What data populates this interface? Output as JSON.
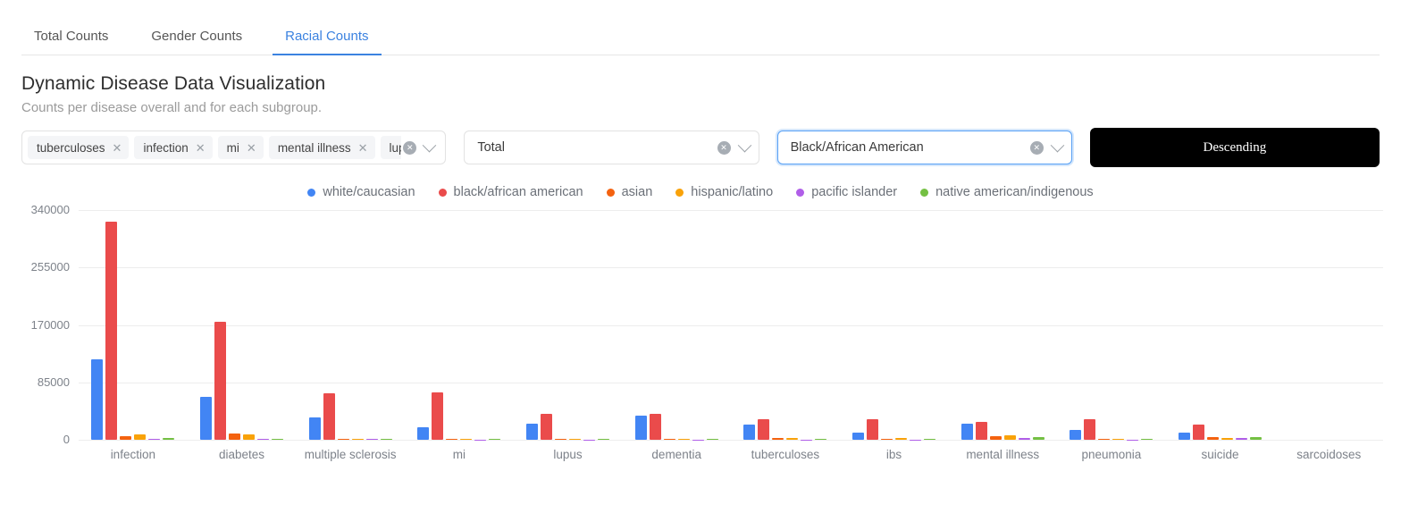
{
  "tabs": [
    {
      "label": "Total Counts",
      "active": false
    },
    {
      "label": "Gender Counts",
      "active": false
    },
    {
      "label": "Racial Counts",
      "active": true
    }
  ],
  "header": {
    "title": "Dynamic Disease Data Visualization",
    "subtitle": "Counts per disease overall and for each subgroup."
  },
  "controls": {
    "disease_multiselect": {
      "chips": [
        "tuberculoses",
        "infection",
        "mi",
        "mental illness",
        "lup"
      ],
      "clear_icon": "clear-circle-icon",
      "chevron_icon": "chevron-down-icon"
    },
    "metric_select": {
      "value": "Total",
      "clear_icon": "clear-circle-icon",
      "chevron_icon": "chevron-down-icon"
    },
    "subgroup_select": {
      "value": "Black/African American",
      "focused": true,
      "clear_icon": "clear-circle-icon",
      "chevron_icon": "chevron-down-icon"
    },
    "sort_button": {
      "label": "Descending"
    }
  },
  "colors": {
    "accent": "#3b82e0",
    "white_caucasian": "#4285f4",
    "black_african_american": "#ea4b4b",
    "asian": "#f4620f",
    "hispanic_latino": "#f9a209",
    "pacific_islander": "#b05ee8",
    "native_american_indigenous": "#74c043",
    "button_bg": "#000000",
    "grid": "#ededed"
  },
  "chart_data": {
    "type": "bar",
    "title": "",
    "xlabel": "",
    "ylabel": "",
    "ylim": [
      0,
      340000
    ],
    "yticks": [
      0,
      85000,
      170000,
      255000,
      340000
    ],
    "ytick_labels": [
      "0",
      "85000",
      "170000",
      "255000",
      "340000"
    ],
    "grid": true,
    "legend_position": "top-center",
    "categories": [
      "infection",
      "diabetes",
      "multiple sclerosis",
      "mi",
      "lupus",
      "dementia",
      "tuberculoses",
      "ibs",
      "mental illness",
      "pneumonia",
      "suicide",
      "sarcoidoses"
    ],
    "series": [
      {
        "name": "white/caucasian",
        "color": "#4285f4",
        "values": [
          119000,
          63000,
          33000,
          19000,
          24000,
          36000,
          22000,
          11000,
          24000,
          14000,
          11000,
          0
        ]
      },
      {
        "name": "black/african american",
        "color": "#ea4b4b",
        "values": [
          323000,
          175000,
          69000,
          70000,
          38000,
          38000,
          30000,
          30000,
          26000,
          30000,
          22000,
          0
        ]
      },
      {
        "name": "asian",
        "color": "#f4620f",
        "values": [
          5000,
          9000,
          2000,
          1500,
          1500,
          2000,
          2500,
          2000,
          5000,
          1500,
          4000,
          0
        ]
      },
      {
        "name": "hispanic/latino",
        "color": "#f9a209",
        "values": [
          8000,
          8000,
          2000,
          1500,
          1500,
          1500,
          2500,
          2500,
          6000,
          1500,
          3000,
          0
        ]
      },
      {
        "name": "pacific islander",
        "color": "#b05ee8",
        "values": [
          1500,
          1500,
          800,
          600,
          600,
          600,
          600,
          600,
          3000,
          600,
          2500,
          0
        ]
      },
      {
        "name": "native american/indigenous",
        "color": "#74c043",
        "values": [
          3000,
          2000,
          1000,
          800,
          800,
          800,
          800,
          800,
          3500,
          800,
          3500,
          0
        ]
      }
    ]
  }
}
